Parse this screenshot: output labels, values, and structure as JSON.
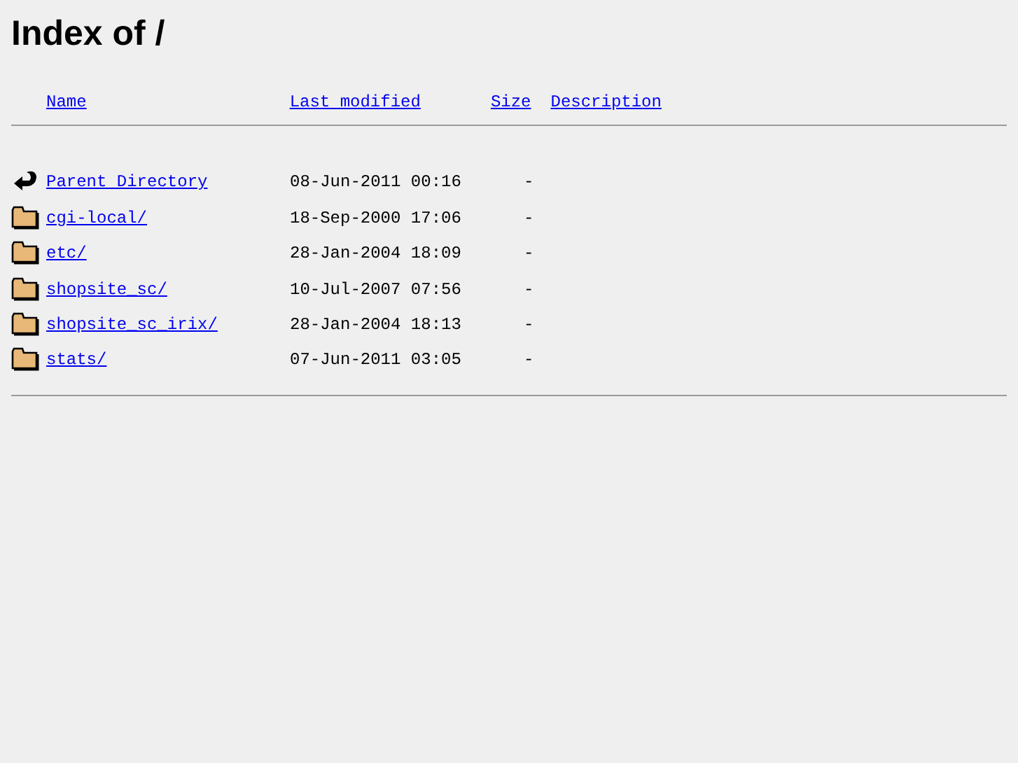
{
  "title": "Index of /",
  "columns": [
    "Name",
    "Last modified",
    "Size",
    "Description"
  ],
  "rows": [
    {
      "kind": "parent",
      "name": "Parent Directory",
      "modified": "08-Jun-2011 00:16",
      "size": "-"
    },
    {
      "kind": "folder",
      "name": "cgi-local/",
      "modified": "18-Sep-2000 17:06",
      "size": "-"
    },
    {
      "kind": "folder",
      "name": "etc/",
      "modified": "28-Jan-2004 18:09",
      "size": "-"
    },
    {
      "kind": "folder",
      "name": "shopsite_sc/",
      "modified": "10-Jul-2007 07:56",
      "size": "-"
    },
    {
      "kind": "folder",
      "name": "shopsite_sc_irix/",
      "modified": "28-Jan-2004 18:13",
      "size": "-"
    },
    {
      "kind": "folder",
      "name": "stats/",
      "modified": "07-Jun-2011 03:05",
      "size": "-"
    }
  ]
}
